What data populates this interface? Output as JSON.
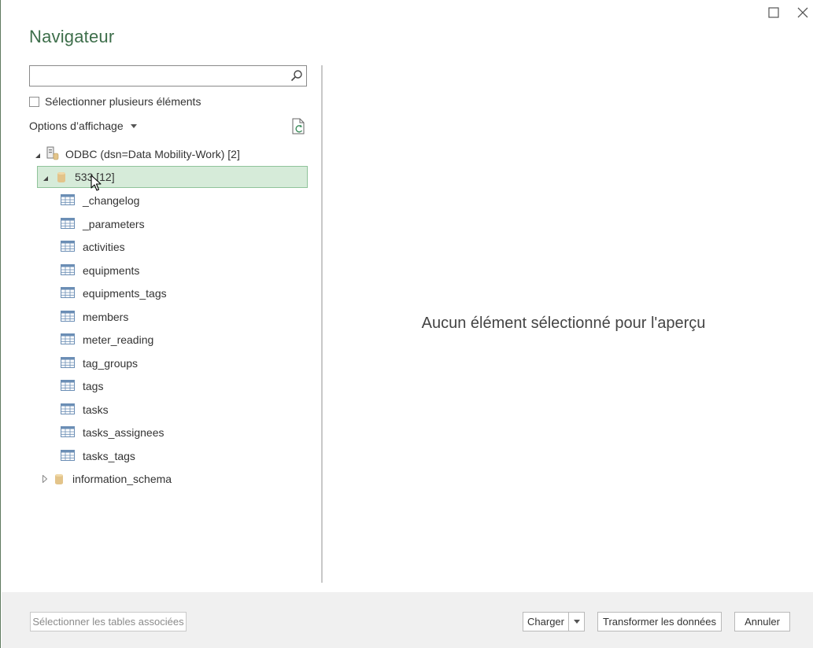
{
  "window": {
    "title": "Navigateur",
    "maximize_icon": "maximize-icon",
    "close_icon": "close-icon"
  },
  "search": {
    "value": "",
    "placeholder": "",
    "icon": "search-icon"
  },
  "multi_select": {
    "label": "Sélectionner plusieurs éléments",
    "checked": false
  },
  "view_options": {
    "label": "Options d’affichage",
    "refresh_icon": "refresh-icon"
  },
  "tree": {
    "root": {
      "label": "ODBC (dsn=Data Mobility-Work) [2]",
      "expanded": true,
      "icon": "odbc-server-icon"
    },
    "schemas": [
      {
        "label": "533 [12]",
        "expanded": true,
        "selected": true,
        "icon": "database-icon",
        "tables": [
          "_changelog",
          "_parameters",
          "activities",
          "equipments",
          "equipments_tags",
          "members",
          "meter_reading",
          "tag_groups",
          "tags",
          "tasks",
          "tasks_assignees",
          "tasks_tags"
        ]
      },
      {
        "label": "information_schema",
        "expanded": false,
        "selected": false,
        "icon": "database-icon"
      }
    ]
  },
  "preview": {
    "empty_message": "Aucun élément sélectionné pour l'aperçu"
  },
  "footer": {
    "select_related_label": "Sélectionner les tables associées",
    "load_label": "Charger",
    "transform_label": "Transformer les données",
    "cancel_label": "Annuler"
  },
  "colors": {
    "title": "#3d6e4a",
    "selection_bg": "#d6ebd9",
    "selection_border": "#8fc39a",
    "footer_bg": "#f0f0f0"
  }
}
